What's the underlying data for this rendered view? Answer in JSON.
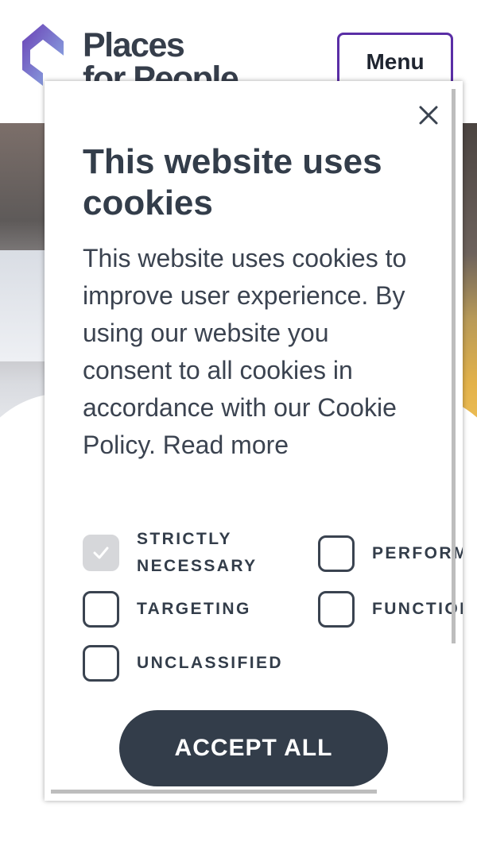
{
  "header": {
    "logo_line1": "Places",
    "logo_line2": "for People",
    "menu_label": "Menu",
    "brand_color": "#5a2ea6"
  },
  "dialog": {
    "close_icon": "close-icon",
    "title": "This website uses cookies",
    "body": "This website uses cookies to improve user experience. By using our website you consent to all cookies in accordance with our Cookie Policy.",
    "read_more": "Read more",
    "options": [
      {
        "label_line1": "STRICTLY",
        "label_line2": "NECESSARY",
        "checked": true,
        "disabled": true
      },
      {
        "label": "PERFORMANCE",
        "checked": false
      },
      {
        "label": "TARGETING",
        "checked": false
      },
      {
        "label": "FUNCTIONALITY",
        "checked": false
      },
      {
        "label": "UNCLASSIFIED",
        "checked": false
      }
    ],
    "accept_label": "ACCEPT ALL",
    "accent_color": "#333d4a"
  }
}
